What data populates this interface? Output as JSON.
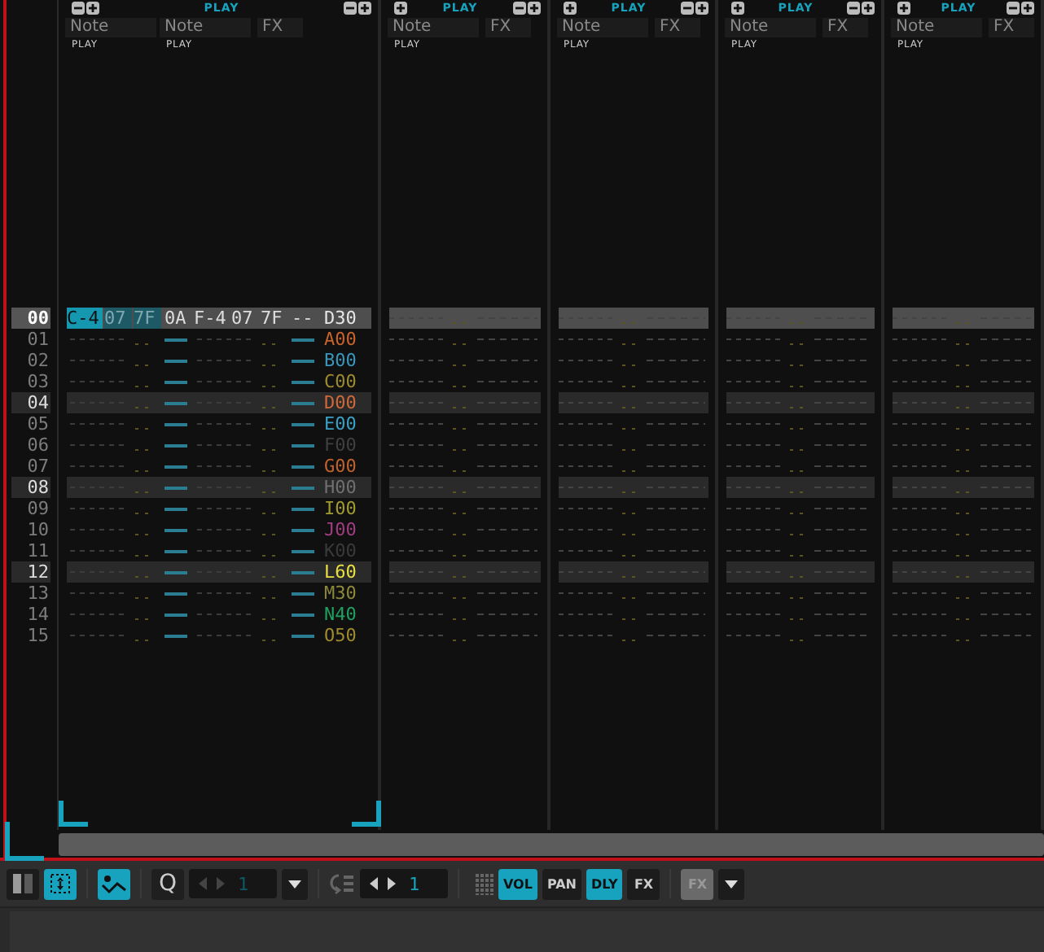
{
  "row_numbers": [
    {
      "label": "00",
      "beat": true,
      "selected": true
    },
    {
      "label": "01",
      "beat": false,
      "selected": false
    },
    {
      "label": "02",
      "beat": false,
      "selected": false
    },
    {
      "label": "03",
      "beat": false,
      "selected": false
    },
    {
      "label": "04",
      "beat": true,
      "selected": false
    },
    {
      "label": "05",
      "beat": false,
      "selected": false
    },
    {
      "label": "06",
      "beat": false,
      "selected": false
    },
    {
      "label": "07",
      "beat": false,
      "selected": false
    },
    {
      "label": "08",
      "beat": true,
      "selected": false
    },
    {
      "label": "09",
      "beat": false,
      "selected": false
    },
    {
      "label": "10",
      "beat": false,
      "selected": false
    },
    {
      "label": "11",
      "beat": false,
      "selected": false
    },
    {
      "label": "12",
      "beat": true,
      "selected": false
    },
    {
      "label": "13",
      "beat": false,
      "selected": false
    },
    {
      "label": "14",
      "beat": false,
      "selected": false
    },
    {
      "label": "15",
      "beat": false,
      "selected": false
    }
  ],
  "tracks": [
    {
      "title": "PLAY",
      "can_remove_column": true,
      "columns": [
        {
          "kind": "note",
          "label": "Note",
          "sub": "PLAY"
        },
        {
          "kind": "note",
          "label": "Note",
          "sub": "PLAY"
        },
        {
          "kind": "fx",
          "label": "FX"
        }
      ],
      "rows": [
        {
          "notes": [
            {
              "note": "C-4",
              "instrument": "07",
              "volume": "7F",
              "delay": "0A",
              "cursor": true,
              "selected": true
            },
            {
              "note": "F-4",
              "instrument": "07",
              "volume": "7F",
              "delay": "--",
              "cursor": false,
              "selected": false
            }
          ],
          "fx": {
            "text": "D30"
          }
        },
        {
          "fx": {
            "text": "A00",
            "color": "#c8642a"
          }
        },
        {
          "fx": {
            "text": "B00",
            "color": "#3a96bc"
          }
        },
        {
          "fx": {
            "text": "C00",
            "color": "#9c8c30"
          }
        },
        {
          "fx": {
            "text": "D00",
            "color": "#d0693a"
          }
        },
        {
          "fx": {
            "text": "E00",
            "color": "#3aa0c8"
          }
        },
        {
          "fx": {
            "text": "F00",
            "color": "#404040"
          }
        },
        {
          "fx": {
            "text": "G00",
            "color": "#c0622e"
          }
        },
        {
          "fx": {
            "text": "H00",
            "color": "#707070"
          }
        },
        {
          "fx": {
            "text": "I00",
            "color": "#a09a30"
          }
        },
        {
          "fx": {
            "text": "J00",
            "color": "#a03c80"
          }
        },
        {
          "fx": {
            "text": "K00",
            "color": "#3a3a3a"
          }
        },
        {
          "fx": {
            "text": "L60",
            "color": "#e8e040"
          }
        },
        {
          "fx": {
            "text": "M30",
            "color": "#8c8a3a"
          }
        },
        {
          "fx": {
            "text": "N40",
            "color": "#20a060"
          }
        },
        {
          "fx": {
            "text": "O50",
            "color": "#a08a30"
          }
        }
      ]
    },
    {
      "title": "PLAY",
      "can_remove_column": false,
      "columns": [
        {
          "kind": "note",
          "label": "Note",
          "sub": "PLAY"
        },
        {
          "kind": "fx",
          "label": "FX"
        }
      ]
    },
    {
      "title": "PLAY",
      "can_remove_column": false,
      "columns": [
        {
          "kind": "note",
          "label": "Note",
          "sub": "PLAY"
        },
        {
          "kind": "fx",
          "label": "FX"
        }
      ]
    },
    {
      "title": "PLAY",
      "can_remove_column": false,
      "columns": [
        {
          "kind": "note",
          "label": "Note",
          "sub": "PLAY"
        },
        {
          "kind": "fx",
          "label": "FX"
        }
      ]
    },
    {
      "title": "PLAY",
      "can_remove_column": false,
      "columns": [
        {
          "kind": "note",
          "label": "Note",
          "sub": "PLAY"
        },
        {
          "kind": "fx",
          "label": "FX"
        }
      ]
    }
  ],
  "toolbar": [
    {
      "kind": "split",
      "on": false
    },
    {
      "kind": "expand",
      "on": true
    },
    {
      "kind": "separator"
    },
    {
      "kind": "automation",
      "on": true
    },
    {
      "kind": "separator"
    },
    {
      "kind": "text-button",
      "label": "Q"
    },
    {
      "kind": "stepper",
      "value": "1",
      "disabled": true
    },
    {
      "kind": "dropdown"
    },
    {
      "kind": "separator"
    },
    {
      "kind": "wrap"
    },
    {
      "kind": "stepper",
      "value": "1",
      "disabled": false
    },
    {
      "kind": "separator"
    },
    {
      "kind": "grid"
    },
    {
      "kind": "column-toggle",
      "label": "VOL",
      "on": true,
      "disabled": false
    },
    {
      "kind": "column-toggle",
      "label": "PAN",
      "on": false,
      "disabled": false
    },
    {
      "kind": "column-toggle",
      "label": "DLY",
      "on": true,
      "disabled": false
    },
    {
      "kind": "column-toggle",
      "label": "FX",
      "on": false,
      "disabled": false
    },
    {
      "kind": "separator"
    },
    {
      "kind": "column-toggle",
      "label": "FX",
      "on": false,
      "disabled": true
    },
    {
      "kind": "dropdown"
    }
  ]
}
